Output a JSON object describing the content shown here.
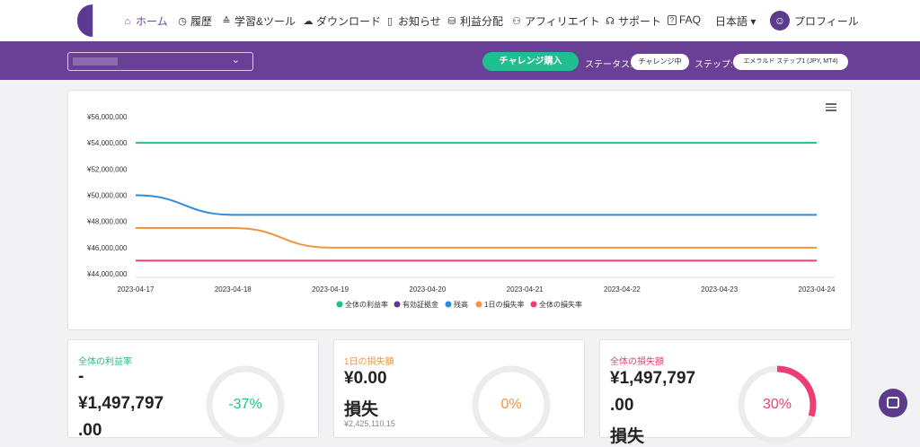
{
  "nav": {
    "items": [
      {
        "label": "ホーム",
        "icon": "home-icon",
        "glyph": "⌂"
      },
      {
        "label": "履歴",
        "icon": "clock-icon",
        "glyph": "◷"
      },
      {
        "label": "学習&ツール",
        "icon": "graduation-cap-icon",
        "glyph": "🎓"
      },
      {
        "label": "ダウンロード",
        "icon": "cloud-download-icon",
        "glyph": "☁"
      },
      {
        "label": "お知らせ",
        "icon": "notice-icon",
        "glyph": "▯"
      },
      {
        "label": "利益分配",
        "icon": "profit-share-icon",
        "glyph": "⛁"
      },
      {
        "label": "アフィリエイト",
        "icon": "affiliate-icon",
        "glyph": "⚇"
      },
      {
        "label": "サポート",
        "icon": "headset-icon",
        "glyph": "☊"
      },
      {
        "label": "FAQ",
        "icon": "question-icon",
        "glyph": "?"
      }
    ],
    "language": "日本語 ▾",
    "profile": "プロフィール"
  },
  "toolbar": {
    "challenge_button": "チャレンジ購入",
    "status_label": "ステータス:",
    "status_value": "チャレンジ中",
    "step_label": "ステップ:",
    "step_value": "エメラルド ステップ1 (JPY, MT4)"
  },
  "colors": {
    "brand": "#6a3f96",
    "green": "#1fbf8f",
    "purple": "#5c3a8e",
    "blue": "#2b8ae2",
    "orange": "#f0953f",
    "pink": "#ee3d73"
  },
  "chart_data": {
    "type": "line",
    "x": [
      "2023-04-17",
      "2023-04-18",
      "2023-04-19",
      "2023-04-20",
      "2023-04-21",
      "2023-04-22",
      "2023-04-23",
      "2023-04-24"
    ],
    "y_ticks": [
      "¥44,000,000",
      "¥46,000,000",
      "¥48,000,000",
      "¥50,000,000",
      "¥52,000,000",
      "¥54,000,000",
      "¥56,000,000"
    ],
    "ylim": [
      44000000,
      56000000
    ],
    "series": [
      {
        "name": "全体の利益率",
        "color": "#1fbf8f",
        "values": [
          54000000,
          54000000,
          54000000,
          54000000,
          54000000,
          54000000,
          54000000,
          54000000
        ]
      },
      {
        "name": "有効証拠金",
        "color": "#5c3a8e",
        "values": []
      },
      {
        "name": "残高",
        "color": "#2b8ae2",
        "values": [
          50000000,
          48502203,
          48502203,
          48502203,
          48502203,
          48502203,
          48502203,
          48502203
        ]
      },
      {
        "name": "1日の損失率",
        "color": "#f0953f",
        "values": [
          47500000,
          47500000,
          46000000,
          46000000,
          46000000,
          46000000,
          46000000,
          46000000
        ]
      },
      {
        "name": "全体の損失率",
        "color": "#ee3d73",
        "values": [
          45000000,
          45000000,
          45000000,
          45000000,
          45000000,
          45000000,
          45000000,
          45000000
        ]
      }
    ]
  },
  "cards": [
    {
      "label": "全体の利益率",
      "line1": "-",
      "line2": "¥1,497,797",
      "line3": ".00",
      "sub": "",
      "gauge": "-37%",
      "fraction": 0
    },
    {
      "label": "1日の損失額",
      "line1": "¥0.00",
      "line2": "損失",
      "line3": "",
      "sub": "¥2,425,110.15",
      "gauge": "0%",
      "fraction": 0
    },
    {
      "label": "全体の損失額",
      "line1": "¥1,497,797",
      "line2": ".00",
      "line3": "損失",
      "sub": "",
      "gauge": "30%",
      "fraction": 0.3
    }
  ]
}
